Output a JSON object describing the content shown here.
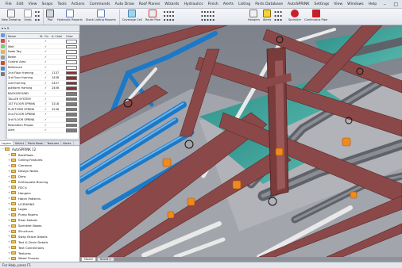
{
  "menu": [
    "File",
    "Edit",
    "View",
    "Snaps",
    "Tools",
    "Actions",
    "Commands",
    "Auto Draw",
    "Roof Planes",
    "Wizards",
    "Hydraulics",
    "Finish",
    "Alerts",
    "Listing",
    "Parts Database",
    "AutoSPRINK",
    "Settings",
    "View",
    "Windows",
    "Help"
  ],
  "ribbon": {
    "new_drawing": "New Drawing",
    "undo": "Undo",
    "plot": "Plot",
    "hydraulic_reports": "Hydraulic Reports",
    "stock_listing_reports": "Stock Listing Reports",
    "coverage_cell": "Coverage Cell",
    "route_pipe": "Route Pipe",
    "hangers": "Hangers",
    "alerts": "Alerts",
    "sprinkler": "Sprinkler",
    "continuous_pipe": "Continuous Pipe"
  },
  "layers_panel": {
    "columns": [
      "Name",
      "St.",
      "On",
      "A. Color",
      "Color"
    ],
    "rows": [
      {
        "name": "0",
        "on": "✓",
        "st": "",
        "color": "#ffffff"
      },
      {
        "name": "Wall",
        "on": "✓",
        "st": "",
        "color": "#ffffff"
      },
      {
        "name": "Node Tag",
        "on": "✓",
        "st": "",
        "color": "#ffffff"
      },
      {
        "name": "Beam",
        "on": "✓",
        "st": "",
        "color": "#ffffff"
      },
      {
        "name": "Control Area",
        "on": "✓",
        "st": "",
        "color": "#ffffff"
      },
      {
        "name": "Reference",
        "on": "✓",
        "st": "",
        "color": "#ffffff"
      },
      {
        "name": "2nd Floor framing",
        "on": "✓",
        "st": "",
        "color": "#8a2f2f"
      },
      {
        "name": "3rd Floor framing",
        "on": "✓",
        "st": "",
        "color": "#8a2f2f"
      },
      {
        "name": "roof framing",
        "on": "✓",
        "st": "",
        "color": "#8a2f2f"
      },
      {
        "name": "platform framing",
        "on": "✓",
        "st": "",
        "color": "#8a2f2f"
      },
      {
        "name": "BACKGROUND",
        "on": "✓",
        "st": "",
        "color": "#7c7c7c"
      },
      {
        "name": "TALLER SYSTEM",
        "on": "✓",
        "st": "",
        "color": "#7c7c7c"
      },
      {
        "name": "1ST FLOOR SPRINK",
        "on": "✓",
        "st": "",
        "color": "#7c7c7c"
      },
      {
        "name": "PLATFORM SPRINK",
        "on": "✓",
        "st": "",
        "color": "#7c7c7c"
      },
      {
        "name": "2nd FLOOR SPRINK",
        "on": "✓",
        "st": "",
        "color": "#7c7c7c"
      },
      {
        "name": "3rd FLOOR SPRINK",
        "on": "✓",
        "st": "",
        "color": "#7c7c7c"
      },
      {
        "name": "Resolution Propos",
        "on": "✓",
        "st": "",
        "color": "#7c7c7c"
      },
      {
        "name": "Alert",
        "on": "✓",
        "st": "",
        "color": "#7c7c7c"
      }
    ],
    "acolors": [
      "",
      "",
      "",
      "",
      "",
      "",
      "1137",
      "2458",
      "2457",
      "2456",
      "",
      "",
      "3218",
      "3246",
      "",
      "",
      "",
      ""
    ]
  },
  "bottom_tabs": [
    "Layers",
    "Select",
    "Parts Book",
    "Textures",
    "Alerts"
  ],
  "tree": {
    "root": "AutoSPRINK 12",
    "folders": [
      "Backflows",
      "Ceiling Features",
      "Common",
      "Design Notes",
      "Dims",
      "Earthquake Bracing",
      "FDC's",
      "Hangers",
      "Hatch Patterns",
      "LICENSING",
      "Logos",
      "Pump Rooms",
      "Riser Details",
      "Sprinkler Boxes",
      "Structural",
      "Sway Brace Details",
      "Test & Drain Details",
      "Text Connections",
      "Textures",
      "Wood Trusses"
    ],
    "files": [
      "maper",
      "MangePDF.cst"
    ]
  },
  "viewport_tabs": [
    "Model",
    "Sheet 1"
  ],
  "status": "For Help, press F1",
  "colors": {
    "beam": "#8b4848",
    "beam_dark": "#6a3333",
    "pipe_blue": "#1e7fd0",
    "pipe_white": "#ececec",
    "pipe_gray": "#6c6f75",
    "teal": "#3fa39a",
    "fitting": "#f08a1e"
  }
}
